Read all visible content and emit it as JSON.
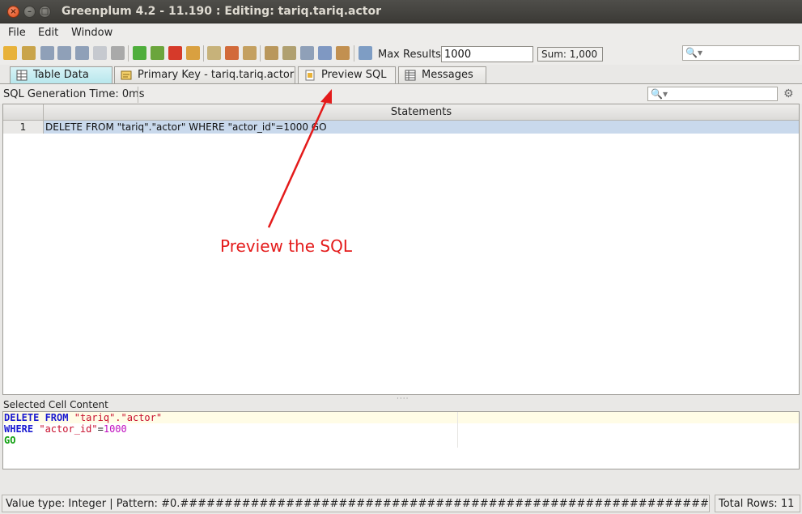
{
  "window": {
    "title": "Greenplum 4.2 - 11.190 : Editing: tariq.tariq.actor",
    "close_glyph": "×",
    "minimize_glyph": "–",
    "maximize_glyph": "□"
  },
  "menu": {
    "file": "File",
    "edit": "Edit",
    "window": "Window"
  },
  "toolbar": {
    "max_results_label": "Max Results:",
    "max_results_value": "1000",
    "sum_label": "Sum: 1,000",
    "search_glyph": "🔍▾"
  },
  "tabs": [
    {
      "label": "Table Data"
    },
    {
      "label": "Primary Key - tariq.tariq.actor"
    },
    {
      "label": "Preview SQL"
    },
    {
      "label": "Messages"
    }
  ],
  "sql_panel": {
    "gen_time": "SQL Generation Time: 0ms",
    "search_glyph": "🔍▾",
    "gear_glyph": "⚙"
  },
  "grid": {
    "column_header": "Statements",
    "rows": [
      {
        "num": "1",
        "statement": "DELETE FROM \"tariq\".\"actor\" WHERE \"actor_id\"=1000 GO"
      }
    ]
  },
  "selected_cell": {
    "label": "Selected Cell Content",
    "line1_kw": "DELETE FROM",
    "line1_str": "\"tariq\".\"actor\"",
    "line2_kw": "WHERE",
    "line2_str": "\"actor_id\"",
    "line2_op": "=",
    "line2_num": "1000",
    "line3": "GO"
  },
  "status": {
    "left": "Value type: Integer | Pattern: #0.#####################################################################",
    "right": "Total Rows: 11"
  },
  "annotation": {
    "text": "Preview the SQL"
  },
  "colors": {
    "annotation": "#e41b1b",
    "selected_row": "#c9d9ec",
    "table_data_tab": "#b6e6ec"
  }
}
